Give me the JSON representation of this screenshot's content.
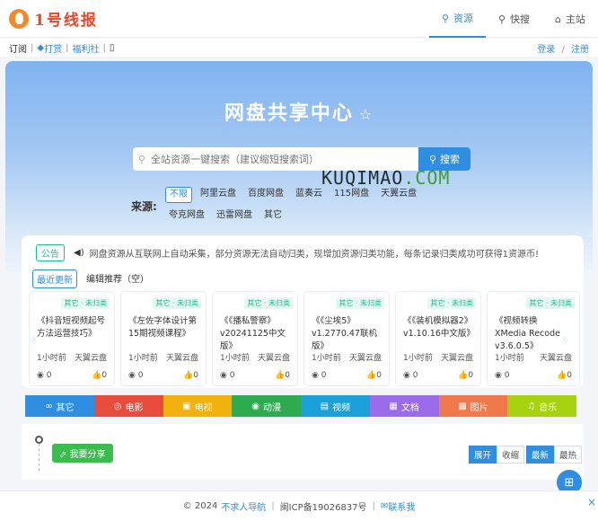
{
  "logo": {
    "text": "1号线报"
  },
  "topnav": [
    {
      "icon": "⚲",
      "label": "资源"
    },
    {
      "icon": "⚲",
      "label": "快搜"
    },
    {
      "icon": "⌂",
      "label": "主站"
    }
  ],
  "subbar": {
    "subscribe": "订阅",
    "reward": "打赏",
    "benefit": "福利社",
    "phone_icon": "▯",
    "login": "登录",
    "slash": "/",
    "register": "注册"
  },
  "hero": {
    "title": "网盘共享中心",
    "star": "☆",
    "search_placeholder": "全站资源一键搜索（建议缩短搜索词）",
    "search_button": "搜索",
    "watermark_a": "KUQIMAO",
    "watermark_b": ".COM",
    "source_label": "来源:",
    "sources": [
      "不限",
      "阿里云盘",
      "百度网盘",
      "蓝奏云",
      "115网盘",
      "天翼云盘",
      "夸克网盘",
      "迅雷网盘",
      "其它"
    ]
  },
  "notice": {
    "tag": "公告",
    "icon": "🔊",
    "text": "网盘资源从互联网上自动采集，部分资源无法自动归类，现增加资源归类功能，每条记录归类成功可获得1资源币!"
  },
  "tabs": [
    "最近更新",
    "编辑推荐（空）"
  ],
  "cards": [
    {
      "badge": "其它 · 未归类",
      "title": "《抖音短视频起号方法运营技巧》",
      "time": "1小时前",
      "disk": "天翼云盘",
      "views": "0",
      "likes": "0"
    },
    {
      "badge": "其它 · 未归类",
      "title": "《左佐字体设计第15期视频课程》",
      "time": "1小时前",
      "disk": "天翼云盘",
      "views": "0",
      "likes": "0"
    },
    {
      "badge": "其它 · 未归类",
      "title": "《《播私警察》v20241125中文版》",
      "time": "1小时前",
      "disk": "天翼云盘",
      "views": "0",
      "likes": "0"
    },
    {
      "badge": "其它 · 未归类",
      "title": "《《尘埃5》v1.2770.47联机版》",
      "time": "1小时前",
      "disk": "天翼云盘",
      "views": "0",
      "likes": "0"
    },
    {
      "badge": "其它 · 未归类",
      "title": "《《装机模拟器2》v1.10.16中文版》",
      "time": "1小时前",
      "disk": "天翼云盘",
      "views": "0",
      "likes": "0"
    },
    {
      "badge": "其它 · 未归类",
      "title": "《视频转换XMedia Recode v3.6.0.5》",
      "time": "1小时前",
      "disk": "天翼云盘",
      "views": "0",
      "likes": "0"
    }
  ],
  "categories": [
    {
      "icon": "∞",
      "label": "其它",
      "color": "#2f8ee0"
    },
    {
      "icon": "◎",
      "label": "电影",
      "color": "#e74c3c"
    },
    {
      "icon": "▣",
      "label": "电视",
      "color": "#f1b20f"
    },
    {
      "icon": "◉",
      "label": "动漫",
      "color": "#2eaa4f"
    },
    {
      "icon": "▤",
      "label": "视频",
      "color": "#1aa1d9"
    },
    {
      "icon": "▦",
      "label": "文档",
      "color": "#9b6bea"
    },
    {
      "icon": "▩",
      "label": "图片",
      "color": "#f07a4b"
    },
    {
      "icon": "♫",
      "label": "音乐",
      "color": "#a6d20f"
    }
  ],
  "flow": {
    "share": "我要分享",
    "expand": "展开",
    "collapse": "收缩",
    "newest": "最新",
    "hottest": "最热"
  },
  "footer": {
    "copyright": "© 2024",
    "site": "不求人导航",
    "icp": "闽ICP备19026837号",
    "contact": "联系我"
  },
  "fab_icon": "⊞",
  "close_icon": "×"
}
